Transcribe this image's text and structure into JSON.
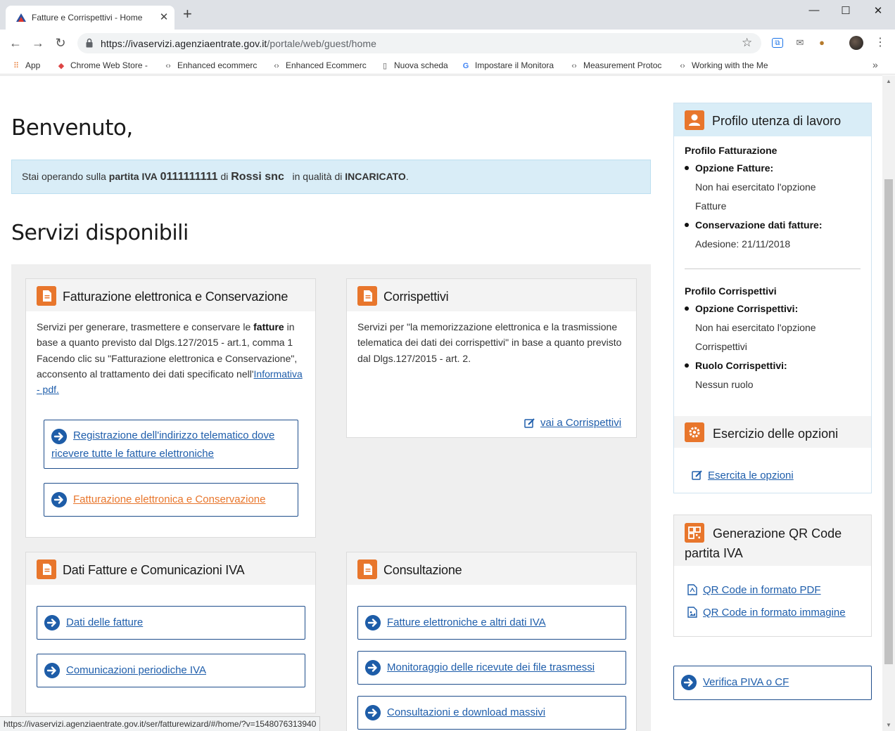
{
  "browser": {
    "tab_title": "Fatture e Corrispettivi - Home",
    "tab_close": "✕",
    "new_tab": "+",
    "window_minimize": "—",
    "window_maximize": "☐",
    "window_close": "✕",
    "url_host": "https://ivaservizi.agenziaentrate.gov.it",
    "url_path": "/portale/web/guest/home",
    "bookmarks": [
      {
        "label": "App",
        "icon": "apps-grid-icon"
      },
      {
        "label": "Chrome Web Store -",
        "icon": "chrome-web-store-icon"
      },
      {
        "label": "Enhanced ecommerc",
        "icon": "code-icon"
      },
      {
        "label": "Enhanced Ecommerc",
        "icon": "code-icon"
      },
      {
        "label": "Nuova scheda",
        "icon": "page-icon"
      },
      {
        "label": "Impostare il Monitora",
        "icon": "google-icon"
      },
      {
        "label": "Measurement Protoc",
        "icon": "code-icon"
      },
      {
        "label": "Working with the Me",
        "icon": "code-icon"
      }
    ],
    "bookmarks_more": "»",
    "status_url": "https://ivaservizi.agenziaentrate.gov.it/ser/fatturewizard/#/home/?v=1548076313940"
  },
  "page": {
    "welcome": "Benvenuto,",
    "info": {
      "prefix": "Stai operando sulla",
      "partita_label": "partita IVA",
      "partita_value": "0111111111",
      "di": "di",
      "company": "Rossi snc",
      "role_prefix": "in qualità di",
      "role": "INCARICATO",
      "suffix": "."
    },
    "services_title": "Servizi disponibili",
    "cards": {
      "fatturazione": {
        "title": "Fatturazione elettronica e Conservazione",
        "text_1": "Servizi per generare, trasmettere e conservare le",
        "text_bold": "fatture",
        "text_2": "in base a quanto previsto dal Dlgs.127/2015 - art.1, comma 1",
        "text_3": "Facendo clic su \"Fatturazione elettronica e Conservazione\", acconsento al trattamento dei dati specificato nell'",
        "link_informativa": "Informativa - pdf.",
        "button_registrazione_1": "Registrazione dell'indirizzo telematico dove",
        "button_registrazione_2": "ricevere tutte le fatture elettroniche",
        "button_fatturazione": "Fatturazione elettronica e Conservazione"
      },
      "corrispettivi": {
        "title": "Corrispettivi",
        "text": "Servizi per \"la memorizzazione elettronica e la trasmissione telematica dei dati dei corrispettivi\" in base a quanto previsto dal Dlgs.127/2015 - art. 2.",
        "link": "vai a Corrispettivi"
      },
      "dati_fatture": {
        "title": "Dati Fatture e Comunicazioni IVA",
        "button_dati": "Dati delle fatture",
        "button_comunicazioni": "Comunicazioni periodiche IVA"
      },
      "consultazione": {
        "title": "Consultazione",
        "button_fatture": "Fatture elettroniche e altri dati IVA",
        "button_monitoraggio": "Monitoraggio delle ricevute dei file trasmessi",
        "button_download": "Consultazioni e download massivi"
      }
    },
    "sidebar": {
      "profilo_title": "Profilo utenza di lavoro",
      "profilo_fatturazione": "Profilo Fatturazione",
      "opzione_fatture_label": "Opzione Fatture:",
      "opzione_fatture_value_1": "Non hai esercitato l'opzione",
      "opzione_fatture_value_2": "Fatture",
      "conservazione_label": "Conservazione dati fatture:",
      "conservazione_value": "Adesione: 21/11/2018",
      "profilo_corrispettivi": "Profilo Corrispettivi",
      "opzione_corrispettivi_label": "Opzione Corrispettivi:",
      "opzione_corrispettivi_value_1": "Non hai esercitato l'opzione",
      "opzione_corrispettivi_value_2": "Corrispettivi",
      "ruolo_label": "Ruolo Corrispettivi:",
      "ruolo_value": "Nessun ruolo",
      "esercizio_title": "Esercizio delle opzioni",
      "esercita_link": "Esercita le opzioni",
      "qr_title_1": "Generazione QR Code",
      "qr_title_2": "partita IVA",
      "qr_pdf": "QR Code in formato PDF",
      "qr_image": "QR Code in formato immagine",
      "verifica": "Verifica PIVA o CF"
    }
  },
  "colors": {
    "accent_orange": "#e8762c",
    "link_blue": "#1f5eab",
    "info_bg": "#d9edf7",
    "panel_grey": "#efefef"
  }
}
